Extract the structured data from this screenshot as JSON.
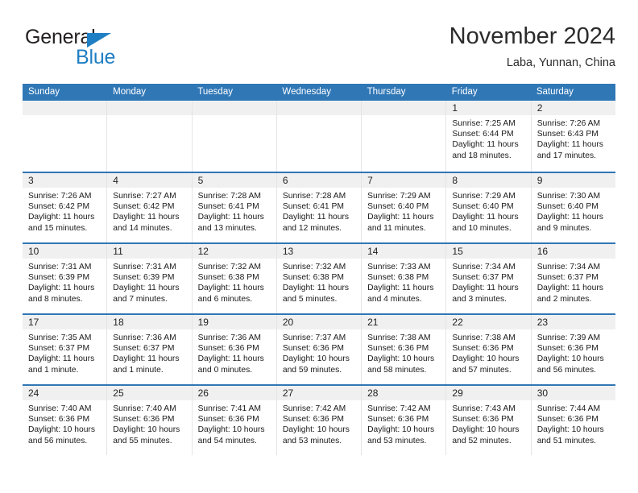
{
  "brand": {
    "name_part1": "General",
    "name_part2": "Blue",
    "accent_color": "#1f7fc4"
  },
  "header": {
    "title": "November 2024",
    "subtitle": "Laba, Yunnan, China"
  },
  "theme": {
    "header_blue": "#3077b6",
    "date_band_gray": "#f0f0f0",
    "grid_line": "#e4e4e4"
  },
  "weekdays": [
    "Sunday",
    "Monday",
    "Tuesday",
    "Wednesday",
    "Thursday",
    "Friday",
    "Saturday"
  ],
  "weeks": [
    [
      {
        "date": "",
        "empty": true,
        "sunrise": "",
        "sunset": "",
        "daylight1": "",
        "daylight2": ""
      },
      {
        "date": "",
        "empty": true,
        "sunrise": "",
        "sunset": "",
        "daylight1": "",
        "daylight2": ""
      },
      {
        "date": "",
        "empty": true,
        "sunrise": "",
        "sunset": "",
        "daylight1": "",
        "daylight2": ""
      },
      {
        "date": "",
        "empty": true,
        "sunrise": "",
        "sunset": "",
        "daylight1": "",
        "daylight2": ""
      },
      {
        "date": "",
        "empty": true,
        "sunrise": "",
        "sunset": "",
        "daylight1": "",
        "daylight2": ""
      },
      {
        "date": "1",
        "empty": false,
        "sunrise": "Sunrise: 7:25 AM",
        "sunset": "Sunset: 6:44 PM",
        "daylight1": "Daylight: 11 hours",
        "daylight2": "and 18 minutes."
      },
      {
        "date": "2",
        "empty": false,
        "sunrise": "Sunrise: 7:26 AM",
        "sunset": "Sunset: 6:43 PM",
        "daylight1": "Daylight: 11 hours",
        "daylight2": "and 17 minutes."
      }
    ],
    [
      {
        "date": "3",
        "empty": false,
        "sunrise": "Sunrise: 7:26 AM",
        "sunset": "Sunset: 6:42 PM",
        "daylight1": "Daylight: 11 hours",
        "daylight2": "and 15 minutes."
      },
      {
        "date": "4",
        "empty": false,
        "sunrise": "Sunrise: 7:27 AM",
        "sunset": "Sunset: 6:42 PM",
        "daylight1": "Daylight: 11 hours",
        "daylight2": "and 14 minutes."
      },
      {
        "date": "5",
        "empty": false,
        "sunrise": "Sunrise: 7:28 AM",
        "sunset": "Sunset: 6:41 PM",
        "daylight1": "Daylight: 11 hours",
        "daylight2": "and 13 minutes."
      },
      {
        "date": "6",
        "empty": false,
        "sunrise": "Sunrise: 7:28 AM",
        "sunset": "Sunset: 6:41 PM",
        "daylight1": "Daylight: 11 hours",
        "daylight2": "and 12 minutes."
      },
      {
        "date": "7",
        "empty": false,
        "sunrise": "Sunrise: 7:29 AM",
        "sunset": "Sunset: 6:40 PM",
        "daylight1": "Daylight: 11 hours",
        "daylight2": "and 11 minutes."
      },
      {
        "date": "8",
        "empty": false,
        "sunrise": "Sunrise: 7:29 AM",
        "sunset": "Sunset: 6:40 PM",
        "daylight1": "Daylight: 11 hours",
        "daylight2": "and 10 minutes."
      },
      {
        "date": "9",
        "empty": false,
        "sunrise": "Sunrise: 7:30 AM",
        "sunset": "Sunset: 6:40 PM",
        "daylight1": "Daylight: 11 hours",
        "daylight2": "and 9 minutes."
      }
    ],
    [
      {
        "date": "10",
        "empty": false,
        "sunrise": "Sunrise: 7:31 AM",
        "sunset": "Sunset: 6:39 PM",
        "daylight1": "Daylight: 11 hours",
        "daylight2": "and 8 minutes."
      },
      {
        "date": "11",
        "empty": false,
        "sunrise": "Sunrise: 7:31 AM",
        "sunset": "Sunset: 6:39 PM",
        "daylight1": "Daylight: 11 hours",
        "daylight2": "and 7 minutes."
      },
      {
        "date": "12",
        "empty": false,
        "sunrise": "Sunrise: 7:32 AM",
        "sunset": "Sunset: 6:38 PM",
        "daylight1": "Daylight: 11 hours",
        "daylight2": "and 6 minutes."
      },
      {
        "date": "13",
        "empty": false,
        "sunrise": "Sunrise: 7:32 AM",
        "sunset": "Sunset: 6:38 PM",
        "daylight1": "Daylight: 11 hours",
        "daylight2": "and 5 minutes."
      },
      {
        "date": "14",
        "empty": false,
        "sunrise": "Sunrise: 7:33 AM",
        "sunset": "Sunset: 6:38 PM",
        "daylight1": "Daylight: 11 hours",
        "daylight2": "and 4 minutes."
      },
      {
        "date": "15",
        "empty": false,
        "sunrise": "Sunrise: 7:34 AM",
        "sunset": "Sunset: 6:37 PM",
        "daylight1": "Daylight: 11 hours",
        "daylight2": "and 3 minutes."
      },
      {
        "date": "16",
        "empty": false,
        "sunrise": "Sunrise: 7:34 AM",
        "sunset": "Sunset: 6:37 PM",
        "daylight1": "Daylight: 11 hours",
        "daylight2": "and 2 minutes."
      }
    ],
    [
      {
        "date": "17",
        "empty": false,
        "sunrise": "Sunrise: 7:35 AM",
        "sunset": "Sunset: 6:37 PM",
        "daylight1": "Daylight: 11 hours",
        "daylight2": "and 1 minute."
      },
      {
        "date": "18",
        "empty": false,
        "sunrise": "Sunrise: 7:36 AM",
        "sunset": "Sunset: 6:37 PM",
        "daylight1": "Daylight: 11 hours",
        "daylight2": "and 1 minute."
      },
      {
        "date": "19",
        "empty": false,
        "sunrise": "Sunrise: 7:36 AM",
        "sunset": "Sunset: 6:36 PM",
        "daylight1": "Daylight: 11 hours",
        "daylight2": "and 0 minutes."
      },
      {
        "date": "20",
        "empty": false,
        "sunrise": "Sunrise: 7:37 AM",
        "sunset": "Sunset: 6:36 PM",
        "daylight1": "Daylight: 10 hours",
        "daylight2": "and 59 minutes."
      },
      {
        "date": "21",
        "empty": false,
        "sunrise": "Sunrise: 7:38 AM",
        "sunset": "Sunset: 6:36 PM",
        "daylight1": "Daylight: 10 hours",
        "daylight2": "and 58 minutes."
      },
      {
        "date": "22",
        "empty": false,
        "sunrise": "Sunrise: 7:38 AM",
        "sunset": "Sunset: 6:36 PM",
        "daylight1": "Daylight: 10 hours",
        "daylight2": "and 57 minutes."
      },
      {
        "date": "23",
        "empty": false,
        "sunrise": "Sunrise: 7:39 AM",
        "sunset": "Sunset: 6:36 PM",
        "daylight1": "Daylight: 10 hours",
        "daylight2": "and 56 minutes."
      }
    ],
    [
      {
        "date": "24",
        "empty": false,
        "sunrise": "Sunrise: 7:40 AM",
        "sunset": "Sunset: 6:36 PM",
        "daylight1": "Daylight: 10 hours",
        "daylight2": "and 56 minutes."
      },
      {
        "date": "25",
        "empty": false,
        "sunrise": "Sunrise: 7:40 AM",
        "sunset": "Sunset: 6:36 PM",
        "daylight1": "Daylight: 10 hours",
        "daylight2": "and 55 minutes."
      },
      {
        "date": "26",
        "empty": false,
        "sunrise": "Sunrise: 7:41 AM",
        "sunset": "Sunset: 6:36 PM",
        "daylight1": "Daylight: 10 hours",
        "daylight2": "and 54 minutes."
      },
      {
        "date": "27",
        "empty": false,
        "sunrise": "Sunrise: 7:42 AM",
        "sunset": "Sunset: 6:36 PM",
        "daylight1": "Daylight: 10 hours",
        "daylight2": "and 53 minutes."
      },
      {
        "date": "28",
        "empty": false,
        "sunrise": "Sunrise: 7:42 AM",
        "sunset": "Sunset: 6:36 PM",
        "daylight1": "Daylight: 10 hours",
        "daylight2": "and 53 minutes."
      },
      {
        "date": "29",
        "empty": false,
        "sunrise": "Sunrise: 7:43 AM",
        "sunset": "Sunset: 6:36 PM",
        "daylight1": "Daylight: 10 hours",
        "daylight2": "and 52 minutes."
      },
      {
        "date": "30",
        "empty": false,
        "sunrise": "Sunrise: 7:44 AM",
        "sunset": "Sunset: 6:36 PM",
        "daylight1": "Daylight: 10 hours",
        "daylight2": "and 51 minutes."
      }
    ]
  ]
}
